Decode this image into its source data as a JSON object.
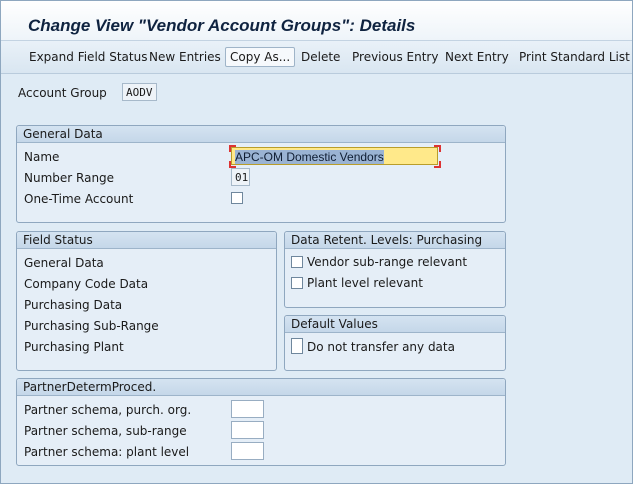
{
  "title": "Change View \"Vendor Account Groups\": Details",
  "toolbar": {
    "expand_field_status": "Expand Field Status",
    "new_entries": "New Entries",
    "copy_as": "Copy As...",
    "delete": "Delete",
    "previous_entry": "Previous Entry",
    "next_entry": "Next Entry",
    "print_standard_list": "Print Standard List"
  },
  "account_group": {
    "label": "Account Group",
    "value": "AODV"
  },
  "general_data": {
    "title": "General Data",
    "name_label": "Name",
    "name_value": "APC-OM Domestic Vendors",
    "number_range_label": "Number Range",
    "number_range_value": "01",
    "one_time_account_label": "One-Time Account"
  },
  "field_status": {
    "title": "Field Status",
    "items": [
      "General Data",
      "Company Code Data",
      "Purchasing Data",
      "Purchasing Sub-Range",
      "Purchasing Plant"
    ]
  },
  "data_retention": {
    "title": "Data Retent. Levels: Purchasing",
    "vendor_subrange": "Vendor sub-range relevant",
    "plant_level": "Plant level relevant"
  },
  "default_values": {
    "title": "Default Values",
    "do_not_transfer": "Do not transfer any data"
  },
  "partner_determination": {
    "title": "PartnerDetermProced.",
    "purch_org_label": "Partner schema, purch. org.",
    "sub_range_label": "Partner schema, sub-range",
    "plant_level_label": "Partner schema: plant level"
  }
}
